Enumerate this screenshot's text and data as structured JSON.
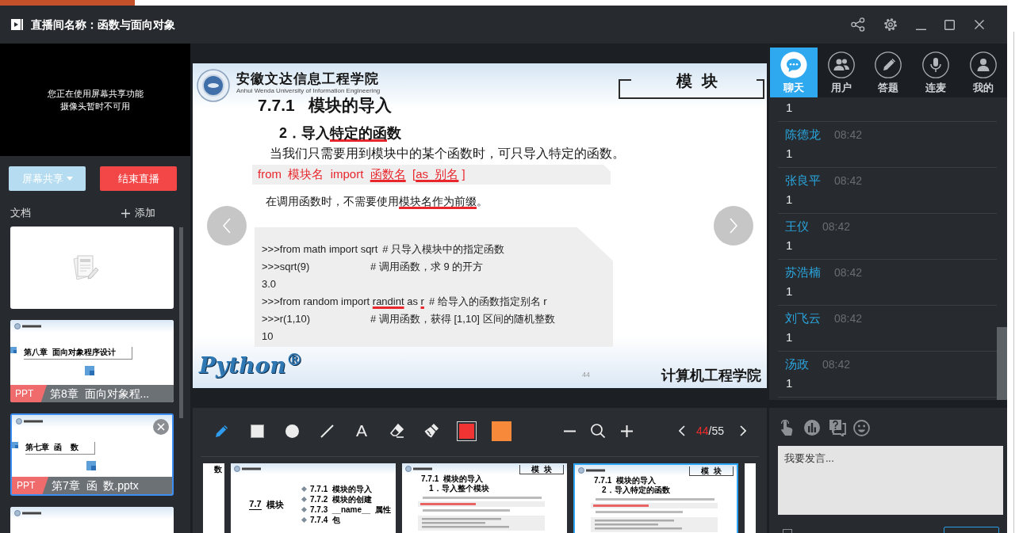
{
  "window": {
    "title": "直播间名称：函数与面向对象"
  },
  "video": {
    "notice": [
      "您正在使用屏幕共享功能",
      "摄像头暂时不可用"
    ]
  },
  "stream_buttons": [
    {
      "label": "屏幕共享",
      "kind": "share"
    },
    {
      "label": "结束直播",
      "kind": "end"
    }
  ],
  "documents": {
    "title": "文档",
    "add_label": "添加",
    "items": [
      {
        "kind": "blank",
        "selected": false
      },
      {
        "kind": "ppt",
        "slide_title": "第八章  面向对象程序设计",
        "tag": "PPT",
        "name": "第8章  面向对象程...",
        "selected": false
      },
      {
        "kind": "ppt",
        "slide_title": "第七章  函    数",
        "tag": "PPT",
        "name": "第7章  函  数.pptx",
        "selected": true
      },
      {
        "kind": "ppt",
        "selected": false
      }
    ]
  },
  "slide": {
    "school_name": "安徽文达信息工程学院",
    "school_name_en": "Anhui Wenda University of Information Engineering",
    "section_tag": "模  块",
    "heading": "7.7.1   模块的导入",
    "subheading": "2．导入特定的函数",
    "intro": "当我们只需要用到模块中的某个函数时，可只导入特定的函数。",
    "syntax": "from  模块名  import  函数名  [as  别名 ]",
    "note": "在调用函数时，不需要使用模块名作为前缀。",
    "code_lines": [
      {
        "code": ">>>from math import sqrt",
        "comment": "# 只导入模块中的指定函数"
      },
      {
        "code": ">>>sqrt(9)",
        "comment": "# 调用函数，求 9 的开方"
      },
      {
        "code": "3.0"
      },
      {
        "code": ">>>from random import randint as r",
        "comment": "# 给导入的函数指定别名 r"
      },
      {
        "code": ">>>r(1,10)",
        "comment": "# 调用函数，获得 [1,10] 区间的随机整数"
      },
      {
        "code": "10"
      }
    ],
    "logo_text": "Python$^{®}$",
    "page_number": "44",
    "footer": "计算机工程学院"
  },
  "toolbar": {
    "tools": [
      {
        "kind": "pen",
        "selected": true
      },
      {
        "kind": "rectangle",
        "selected": false
      },
      {
        "kind": "circle",
        "selected": false
      },
      {
        "kind": "line",
        "selected": false
      },
      {
        "kind": "text",
        "glyph": "A",
        "selected": false
      },
      {
        "kind": "eraser",
        "selected": false
      },
      {
        "kind": "clear",
        "selected": false
      }
    ],
    "colors": [
      {
        "color": "#f03434",
        "selected": true
      },
      {
        "color": "#f78a3a",
        "selected": false
      }
    ],
    "pager": {
      "current": "44",
      "separator": "/",
      "total": "55"
    }
  },
  "thumbnails": [
    {
      "kind": "cut",
      "heading": "数",
      "selected": false
    },
    {
      "kind": "toc",
      "title_number": "7.7",
      "title": "模块",
      "items": [
        "7.7.1  模块的导入",
        "7.7.2  模块的创建",
        "7.7.3  __name__  属性",
        "7.7.4  包"
      ],
      "selected": false
    },
    {
      "kind": "content",
      "tag": "模  块",
      "heading": "7.7.1  模块的导入",
      "subheading": "1．导入整个模块",
      "selected": false
    },
    {
      "kind": "content",
      "tag": "模  块",
      "heading": "7.7.1  模块的导入",
      "subheading": "2．导入特定的函数",
      "selected": true
    },
    {
      "kind": "cut",
      "selected": false
    }
  ],
  "chat": {
    "tabs": [
      {
        "label": "聊天",
        "kind": "chat",
        "selected": true
      },
      {
        "label": "用户",
        "kind": "users",
        "selected": false
      },
      {
        "label": "答题",
        "kind": "answer",
        "selected": false
      },
      {
        "label": "连麦",
        "kind": "mic",
        "selected": false
      },
      {
        "label": "我的",
        "kind": "me",
        "selected": false
      }
    ],
    "messages": [
      {
        "text": "1"
      },
      {
        "name": "陈德龙",
        "time": "08:42",
        "text": "1"
      },
      {
        "name": "张良平",
        "time": "08:42",
        "text": "1"
      },
      {
        "name": "王仪",
        "time": "08:42",
        "text": "1"
      },
      {
        "name": "苏浩楠",
        "time": "08:42",
        "text": "1"
      },
      {
        "name": "刘飞云",
        "time": "08:42",
        "text": "1"
      },
      {
        "name": "汤政",
        "time": "08:42",
        "text": "1"
      }
    ],
    "input": {
      "placeholder": "我要发言..."
    },
    "mute_checkbox": {
      "checked": false
    }
  }
}
